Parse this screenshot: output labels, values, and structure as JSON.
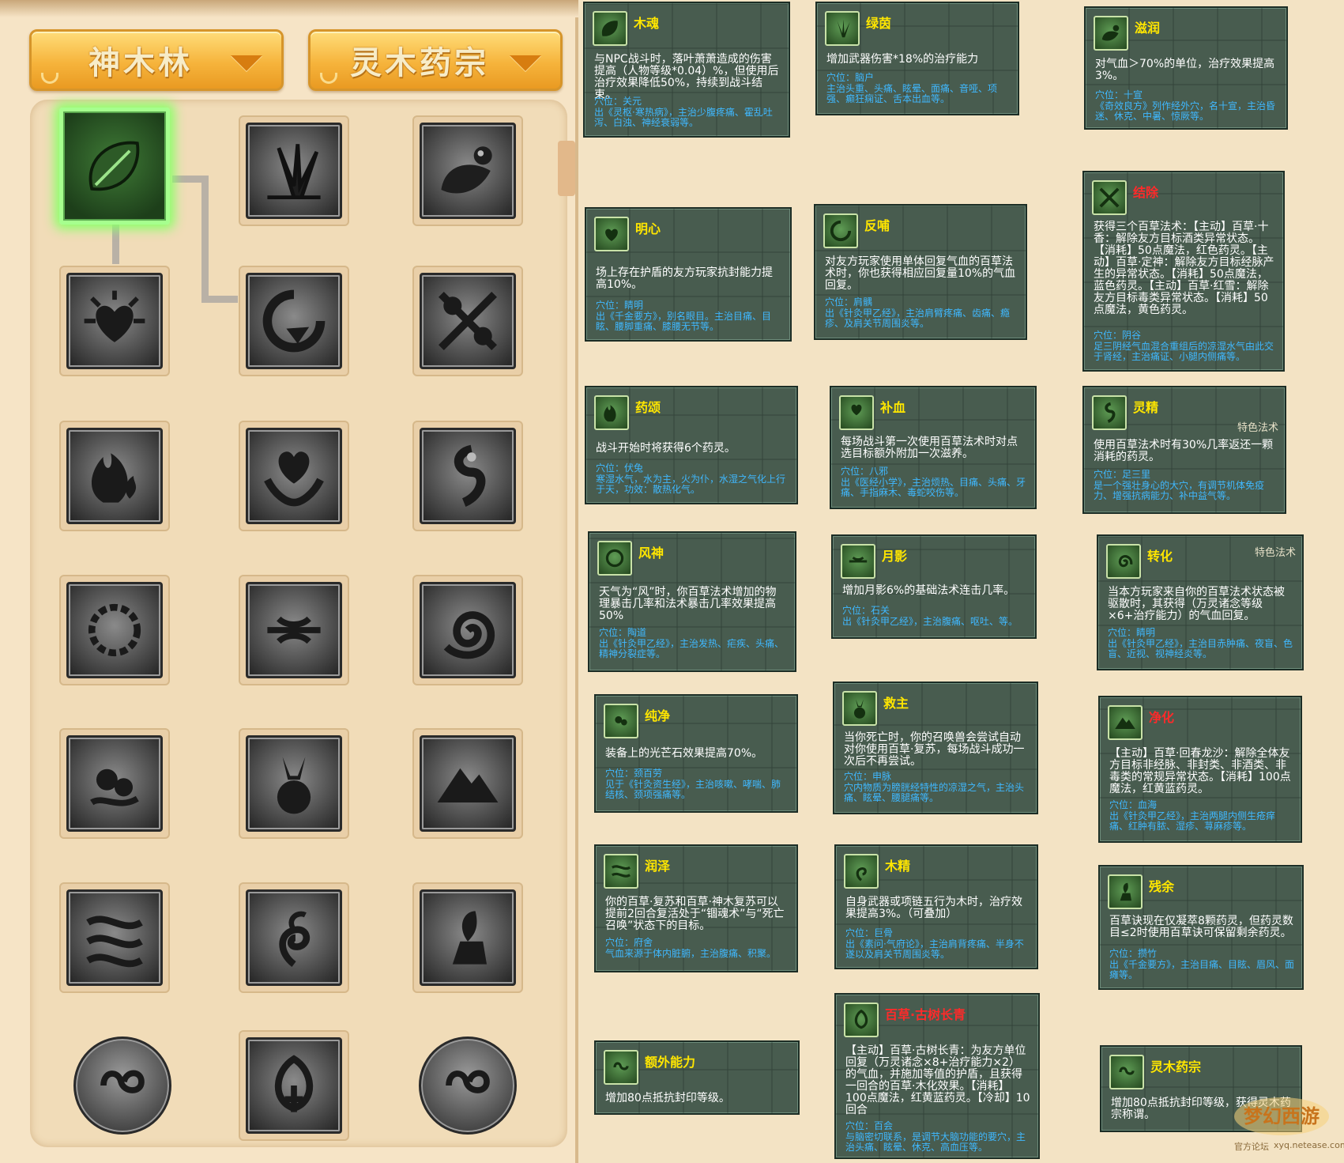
{
  "tabs": {
    "school": "神木林",
    "sect": "灵木药宗"
  },
  "tooltips": [
    {
      "id": "muhun",
      "name": "木魂",
      "desc": "与NPC战斗时，落叶萧萧造成的伤害提高（人物等级*0.04）%，但使用后治疗效果降低50%，持续到战斗结束。",
      "acupoint": "穴位：关元",
      "acupoint_desc": "出《灵枢·寒热病》，主治少腹疼痛、霍乱吐泻、白浊、神经衰弱等。"
    },
    {
      "id": "lvyin",
      "name": "绿茵",
      "desc": "增加武器伤害*18%的治疗能力",
      "acupoint": "穴位：脑户",
      "acupoint_desc": "主治头重、头痛、眩晕、面痛、音哑、项强、癫狂痫证、舌本出血等。"
    },
    {
      "id": "zirun",
      "name": "滋润",
      "desc": "对气血＞70%的单位，治疗效果提高3%。",
      "acupoint": "穴位：十宣",
      "acupoint_desc": "《奇效良方》列作经外穴，名十宣，主治昏迷、休克、中暑、惊厥等。"
    },
    {
      "id": "mingxin",
      "name": "明心",
      "desc": "场上存在护盾的友方玩家抗封能力提高10%。",
      "acupoint": "穴位：睛明",
      "acupoint_desc": "出《千金要方》，别名眼目。主治目痛、目眩、腰脚重痛、膝腰无节等。"
    },
    {
      "id": "fanbu",
      "name": "反哺",
      "desc": "对友方玩家使用单体回复气血的百草法术时，你也获得相应回复量10%的气血回复。",
      "acupoint": "穴位：肩髃",
      "acupoint_desc": "出《针灸甲乙经》，主治肩臂疼痛、齿痛、瘾疹、及肩关节周围炎等。"
    },
    {
      "id": "jiechu",
      "name": "结除",
      "desc": "获得三个百草法术：【主动】百草·十香：解除友方目标酒类异常状态。【消耗】50点魔法，红色药灵。【主动】百草·定神：解除友方目标经脉产生的异常状态。【消耗】50点魔法，蓝色药灵。【主动】百草·红雪：解除友方目标毒类异常状态。【消耗】50点魔法，黄色药灵。",
      "acupoint": "穴位：阴谷",
      "acupoint_desc": "足三阴经气血混合重组后的凉湿水气由此交于肾经，主治痛证、小腿内侧痛等。"
    },
    {
      "id": "yaosong",
      "name": "药颂",
      "desc": "战斗开始时将获得6个药灵。",
      "acupoint": "穴位：伏兔",
      "acupoint_desc": "寒湿水气，水为主，火为仆，水湿之气化上行于天，功效：散热化气。"
    },
    {
      "id": "buxue",
      "name": "补血",
      "desc": "每场战斗第一次使用百草法术时对点选目标额外附加一次滋养。",
      "acupoint": "穴位：八邪",
      "acupoint_desc": "出《医经小学》，主治烦热、目痛、头痛、牙痛、手指麻木、毒蛇咬伤等。"
    },
    {
      "id": "lingjing",
      "name": "灵精",
      "tag": "特色法术",
      "desc": "使用百草法术时有30%几率返还一颗消耗的药灵。",
      "acupoint": "穴位：足三里",
      "acupoint_desc": "是一个强壮身心的大穴，有调节机体免疫力、增强抗病能力、补中益气等。"
    },
    {
      "id": "fengshen",
      "name": "风神",
      "desc": "天气为“风”时，你百草法术增加的物理暴击几率和法术暴击几率效果提高50%",
      "acupoint": "穴位：陶道",
      "acupoint_desc": "出《针灸甲乙经》，主治发热、疟疾、头痛、精神分裂症等。"
    },
    {
      "id": "yueying",
      "name": "月影",
      "desc": "增加月影6%的基础法术连击几率。",
      "acupoint": "穴位：石关",
      "acupoint_desc": "出《针灸甲乙经》，主治腹痛、呕吐、等。"
    },
    {
      "id": "zhuanhua",
      "name": "转化",
      "tag": "特色法术",
      "desc": "当本方玩家来自你的百草法术状态被驱散时，其获得（万灵诸念等级×6+治疗能力）的气血回复。",
      "acupoint": "穴位：睛明",
      "acupoint_desc": "出《针灸甲乙经》，主治目赤肿痛、夜盲、色盲、近视、视神经炎等。"
    },
    {
      "id": "chunjing",
      "name": "纯净",
      "desc": "装备上的光芒石效果提高70%。",
      "acupoint": "穴位：颈百劳",
      "acupoint_desc": "见于《针灸资生经》，主治咳嗽、哮喘、肺结核、颈项强痛等。"
    },
    {
      "id": "jiuzhu",
      "name": "救主",
      "desc": "当你死亡时，你的召唤兽会尝试自动对你使用百草·复苏，每场战斗成功一次后不再尝试。",
      "acupoint": "穴位：申脉",
      "acupoint_desc": "穴内物质为膀胱经特性的凉湿之气，主治头痛、眩晕、腰腿痛等。"
    },
    {
      "id": "jinghua",
      "name": "净化",
      "desc": "【主动】百草·回春龙沙：解除全体友方目标非经脉、非封类、非酒类、非毒类的常规异常状态。【消耗】100点魔法，红黄蓝药灵。",
      "acupoint": "穴位：血海",
      "acupoint_desc": "出《针灸甲乙经》，主治两腿内侧生疮痒痛、红肿有脓、湿疹、荨麻疹等。"
    },
    {
      "id": "runze",
      "name": "润泽",
      "desc": "你的百草·复苏和百草·神木复苏可以提前2回合复活处于“锢魂术”与“死亡召唤”状态下的目标。",
      "acupoint": "穴位：府舍",
      "acupoint_desc": "气血来源于体内脏腑，主治腹痛、积聚。"
    },
    {
      "id": "mujing",
      "name": "木精",
      "desc": "自身武器或项链五行为木时，治疗效果提高3%。（可叠加）",
      "acupoint": "穴位：巨骨",
      "acupoint_desc": "出《素问·气府论》，主治肩背疼痛、半身不遂以及肩关节周围炎等。"
    },
    {
      "id": "cangyu",
      "name": "残余",
      "desc": "百草诀现在仅凝萃8颗药灵，但药灵数目≤2时使用百草诀可保留剩余药灵。",
      "acupoint": "穴位：攒竹",
      "acupoint_desc": "出《千金要方》，主治目痛、目眩、眉风、面瘫等。"
    },
    {
      "id": "ewai",
      "name": "额外能力",
      "desc": "增加80点抵抗封印等级。"
    },
    {
      "id": "gushuchangqing",
      "name": "百草·古树长青",
      "desc": "【主动】百草·古树长青：为友方单位回复（万灵诸念×8+治疗能力×2）的气血，并施加等值的护盾，且获得一回合的百草·木化效果。【消耗】100点魔法，红黄蓝药灵。【冷却】10回合",
      "acupoint": "穴位：百会",
      "acupoint_desc": "与脑密切联系，是调节大脑功能的要穴，主治头痛、眩晕、休克、高血压等。"
    },
    {
      "id": "lingmu",
      "name": "灵木药宗",
      "desc": "增加80点抵抗封印等级，获得灵木药宗称谓。"
    }
  ],
  "watermark": {
    "brand": "梦幻西游",
    "sub": "官方论坛",
    "url": "xyq.netease.com"
  }
}
